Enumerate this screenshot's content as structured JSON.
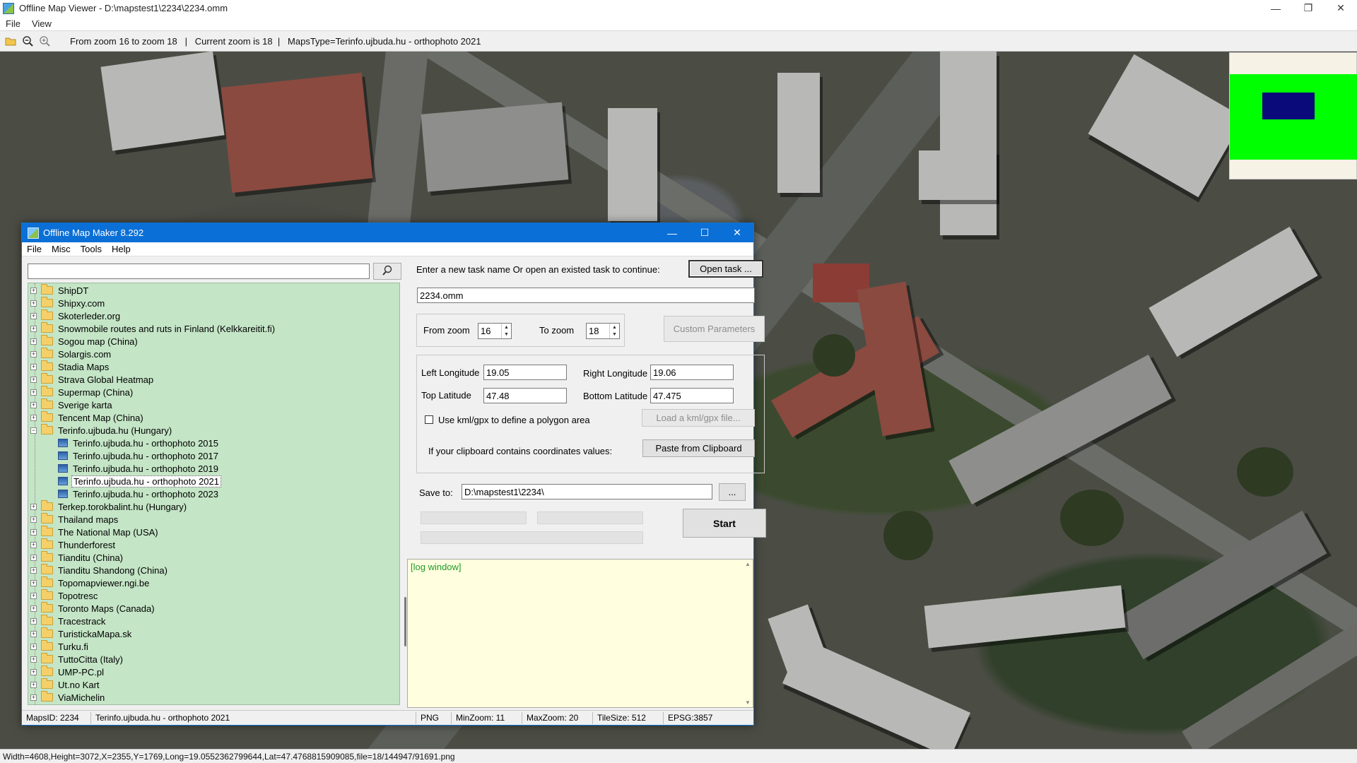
{
  "viewer": {
    "title": "Offline Map Viewer - D:\\mapstest1\\2234\\2234.omm",
    "menu": [
      "File",
      "View"
    ],
    "toolbar_info": "From zoom 16 to zoom 18   |   Current zoom is 18  |   MapsType=Terinfo.ujbuda.hu - orthophoto 2021",
    "status": "Width=4608,Height=3072,X=2355,Y=1769,Long=19.0552362799644,Lat=47.4768815909085,file=18/144947/91691.png",
    "icons": [
      "folder-open-icon",
      "zoom-out-icon",
      "zoom-in-icon"
    ]
  },
  "maker": {
    "title": "Offline Map Maker 8.292",
    "menu": [
      "File",
      "Misc",
      "Tools",
      "Help"
    ],
    "search": {
      "value": "",
      "placeholder": ""
    },
    "tree": [
      {
        "label": "ShipDT",
        "type": "folder",
        "expanded": false
      },
      {
        "label": "Shipxy.com",
        "type": "folder",
        "expanded": false
      },
      {
        "label": "Skoterleder.org",
        "type": "folder",
        "expanded": false
      },
      {
        "label": "Snowmobile routes and ruts in Finland (Kelkkareitit.fi)",
        "type": "folder",
        "expanded": false
      },
      {
        "label": "Sogou map (China)",
        "type": "folder",
        "expanded": false
      },
      {
        "label": "Solargis.com",
        "type": "folder",
        "expanded": false
      },
      {
        "label": "Stadia Maps",
        "type": "folder",
        "expanded": false
      },
      {
        "label": "Strava Global Heatmap",
        "type": "folder",
        "expanded": false
      },
      {
        "label": "Supermap (China)",
        "type": "folder",
        "expanded": false
      },
      {
        "label": "Sverige karta",
        "type": "folder",
        "expanded": false
      },
      {
        "label": "Tencent Map (China)",
        "type": "folder",
        "expanded": false
      },
      {
        "label": "Terinfo.ujbuda.hu (Hungary)",
        "type": "folder",
        "expanded": true
      },
      {
        "label": "Terinfo.ujbuda.hu - orthophoto 2015",
        "type": "leaf"
      },
      {
        "label": "Terinfo.ujbuda.hu - orthophoto 2017",
        "type": "leaf"
      },
      {
        "label": "Terinfo.ujbuda.hu - orthophoto 2019",
        "type": "leaf"
      },
      {
        "label": "Terinfo.ujbuda.hu - orthophoto 2021",
        "type": "leaf",
        "selected": true
      },
      {
        "label": "Terinfo.ujbuda.hu - orthophoto 2023",
        "type": "leaf"
      },
      {
        "label": "Terkep.torokbalint.hu (Hungary)",
        "type": "folder",
        "expanded": false
      },
      {
        "label": "Thailand maps",
        "type": "folder",
        "expanded": false
      },
      {
        "label": "The National Map (USA)",
        "type": "folder",
        "expanded": false
      },
      {
        "label": "Thunderforest",
        "type": "folder",
        "expanded": false
      },
      {
        "label": "Tianditu (China)",
        "type": "folder",
        "expanded": false
      },
      {
        "label": "Tianditu Shandong (China)",
        "type": "folder",
        "expanded": false
      },
      {
        "label": "Topomapviewer.ngi.be",
        "type": "folder",
        "expanded": false
      },
      {
        "label": "Topotresc",
        "type": "folder",
        "expanded": false
      },
      {
        "label": "Toronto Maps (Canada)",
        "type": "folder",
        "expanded": false
      },
      {
        "label": "Tracestrack",
        "type": "folder",
        "expanded": false
      },
      {
        "label": "TuristickaMapa.sk",
        "type": "folder",
        "expanded": false
      },
      {
        "label": "Turku.fi",
        "type": "folder",
        "expanded": false
      },
      {
        "label": "TuttoCitta (Italy)",
        "type": "folder",
        "expanded": false
      },
      {
        "label": "UMP-PC.pl",
        "type": "folder",
        "expanded": false
      },
      {
        "label": "Ut.no Kart",
        "type": "folder",
        "expanded": false
      },
      {
        "label": "ViaMichelin",
        "type": "folder",
        "expanded": false
      }
    ],
    "task": {
      "prompt": "Enter a new task name Or open an existed task to continue:",
      "open_button": "Open task ...",
      "name_value": "2234.omm"
    },
    "zoom": {
      "from_label": "From zoom",
      "from_value": "16",
      "to_label": "To zoom",
      "to_value": "18",
      "custom_button": "Custom Parameters"
    },
    "coords": {
      "left_long_label": "Left Longitude",
      "left_long_value": "19.05",
      "right_long_label": "Right Longitude",
      "right_long_value": "19.06",
      "top_lat_label": "Top Latitude",
      "top_lat_value": "47.48",
      "bottom_lat_label": "Bottom Latitude",
      "bottom_lat_value": "47.475",
      "kml_label": "Use kml/gpx to define a polygon area",
      "kml_checked": false,
      "kml_button": "Load a kml/gpx file...",
      "clipboard_label": "If your clipboard contains coordinates values:",
      "clipboard_button": "Paste from Clipboard"
    },
    "save": {
      "label": "Save to:",
      "path": "D:\\mapstest1\\2234\\",
      "browse_button": "...",
      "start_button": "Start"
    },
    "log": {
      "text": "[log window]"
    },
    "status": {
      "maps_id": "MapsID: 2234",
      "maps_name": "Terinfo.ujbuda.hu - orthophoto 2021",
      "format": "PNG",
      "min_zoom": "MinZoom: 11",
      "max_zoom": "MaxZoom: 20",
      "tile_size": "TileSize: 512",
      "epsg": "EPSG:3857"
    }
  },
  "colors": {
    "maker_titlebar": "#0a6fd6",
    "tree_bg": "#c4e5c6",
    "log_bg": "#ffffe0",
    "log_text": "#1f9b26",
    "minimap_green": "#00ff00",
    "minimap_view": "#0a0a7a"
  }
}
